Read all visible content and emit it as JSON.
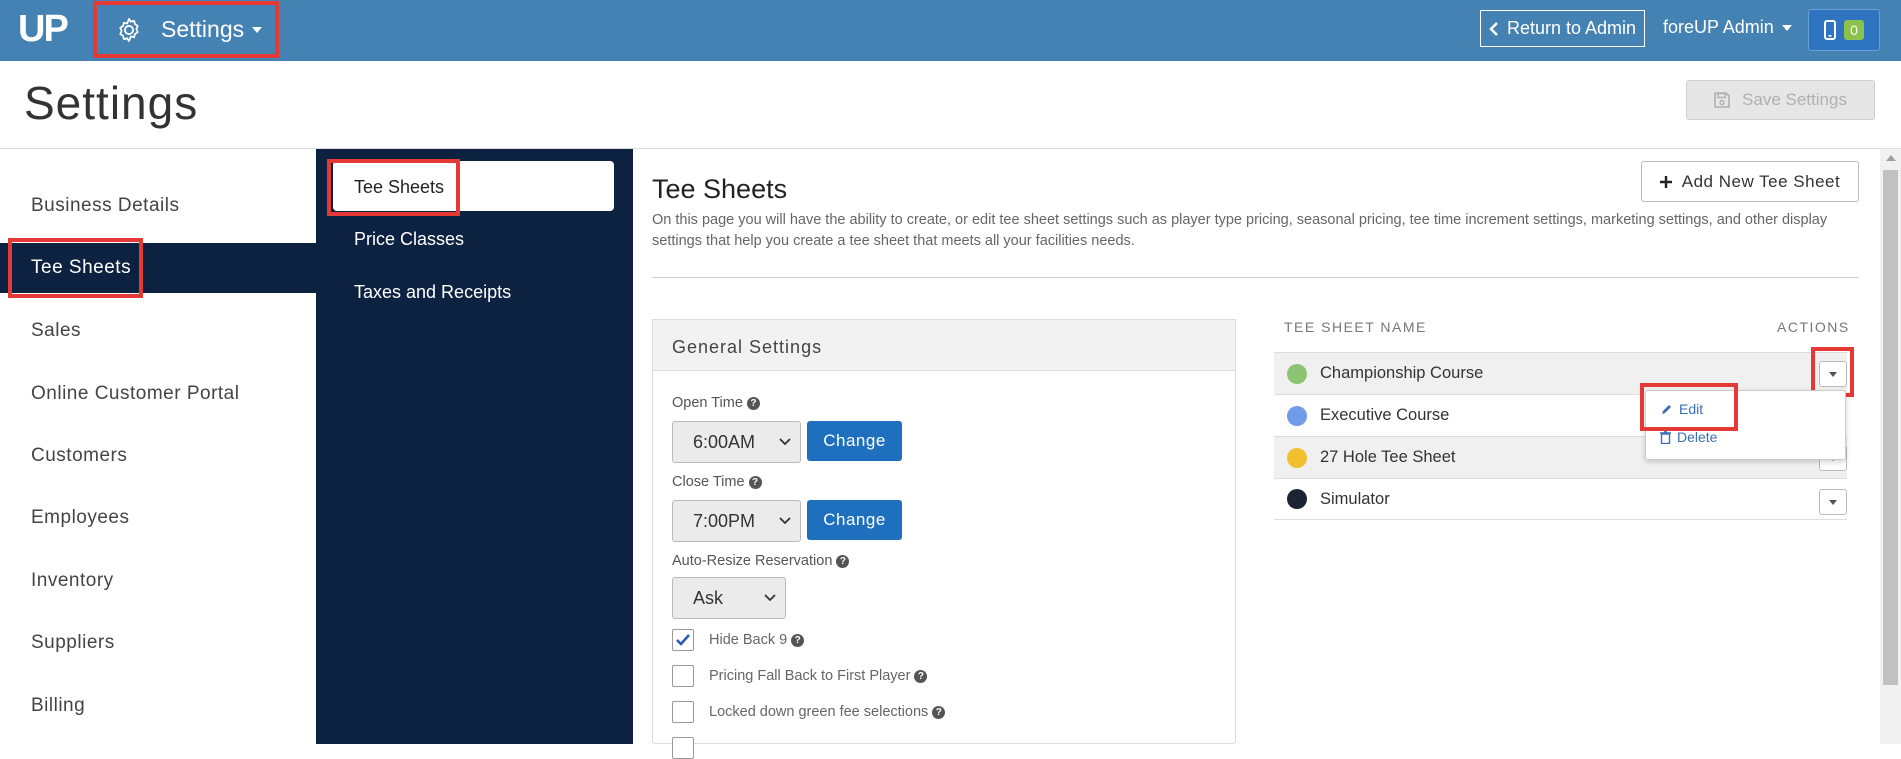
{
  "topbar": {
    "logo": "UP",
    "settings_menu": "Settings",
    "return_label": "Return to Admin",
    "admin_label": "foreUP Admin",
    "phone_count": "0"
  },
  "header": {
    "page_title": "Settings",
    "save_label": "Save Settings"
  },
  "leftnav": {
    "items": [
      "Business Details",
      "Tee Sheets",
      "Sales",
      "Online Customer Portal",
      "Customers",
      "Employees",
      "Inventory",
      "Suppliers",
      "Billing"
    ],
    "active": "Tee Sheets"
  },
  "subnav": {
    "items": [
      "Tee Sheets",
      "Price Classes",
      "Taxes and Receipts"
    ],
    "active": "Tee Sheets"
  },
  "content": {
    "title": "Tee Sheets",
    "description": "On this page you will have the ability to create, or edit tee sheet settings such as player type pricing, seasonal pricing, tee time increment settings, marketing settings, and other display settings that help you create a tee sheet that meets all your facilities needs.",
    "add_label": "Add New Tee Sheet"
  },
  "general_settings": {
    "title": "General Settings",
    "open_time_label": "Open Time",
    "open_time_value": "6:00AM",
    "close_time_label": "Close Time",
    "close_time_value": "7:00PM",
    "change_label": "Change",
    "auto_resize_label": "Auto-Resize Reservation",
    "auto_resize_value": "Ask",
    "checkboxes": [
      {
        "label": "Hide Back 9",
        "checked": true
      },
      {
        "label": "Pricing Fall Back to First Player",
        "checked": false
      },
      {
        "label": "Locked down green fee selections",
        "checked": false
      }
    ]
  },
  "tee_sheets": {
    "col_name": "TEE SHEET NAME",
    "col_actions": "ACTIONS",
    "rows": [
      {
        "name": "Championship Course",
        "color": "#8cc474"
      },
      {
        "name": "Executive Course",
        "color": "#6f9be8"
      },
      {
        "name": "27 Hole Tee Sheet",
        "color": "#f2c02c"
      },
      {
        "name": "Simulator",
        "color": "#1c2433"
      }
    ],
    "menu": {
      "edit": "Edit",
      "delete": "Delete"
    }
  }
}
